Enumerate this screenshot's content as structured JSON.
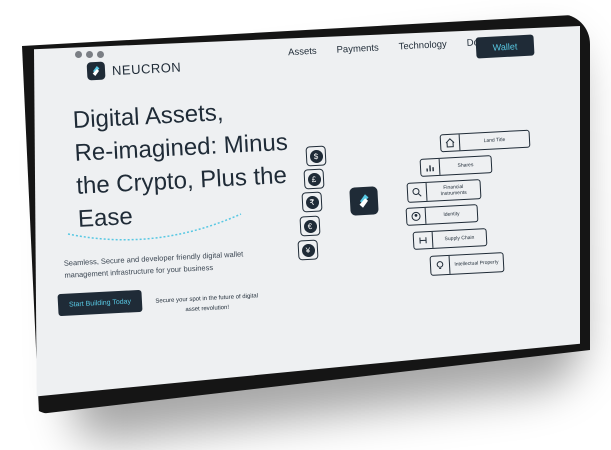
{
  "brand": {
    "name": "NEUCRON"
  },
  "nav": {
    "items": [
      "Assets",
      "Payments",
      "Technology",
      "Docs"
    ],
    "wallet_label": "Wallet"
  },
  "hero": {
    "line1": "Digital Assets,",
    "line2": "Re-imagined: Minus",
    "line3": "the Crypto, Plus the",
    "line4": "Ease",
    "subtitle": "Seamless, Secure and developer friendly digital wallet management infrastructure for your business",
    "cta_label": "Start Building Today",
    "cta_note": "Secure your spot in the future of digital asset revolution!"
  },
  "currencies": [
    "$",
    "£",
    "₹",
    "€",
    "¥"
  ],
  "assets": [
    {
      "label": "Land Title",
      "icon": "house-icon"
    },
    {
      "label": "Shares",
      "icon": "bar-chart-icon"
    },
    {
      "label": "Financial Instruments",
      "icon": "magnifier-icon"
    },
    {
      "label": "Identity",
      "icon": "id-badge-icon"
    },
    {
      "label": "Supply Chain",
      "icon": "network-icon"
    },
    {
      "label": "Intellectual Property",
      "icon": "lightbulb-icon"
    }
  ],
  "colors": {
    "navy": "#1f2b37",
    "accent": "#58c8e3",
    "screen": "#eef0f2",
    "bezel": "#151515"
  }
}
